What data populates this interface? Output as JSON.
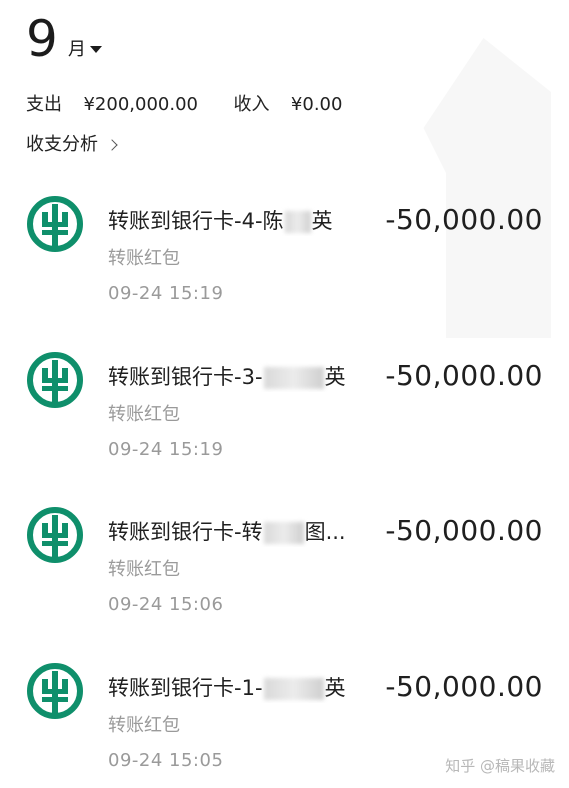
{
  "header": {
    "month": "9",
    "month_unit": "月"
  },
  "summary": {
    "expense_label": "支出",
    "expense_amount": "¥200,000.00",
    "income_label": "收入",
    "income_amount": "¥0.00"
  },
  "analysis": {
    "label": "收支分析"
  },
  "transactions": [
    {
      "title_prefix": "转账到银行卡-4-陈",
      "title_suffix": "英",
      "type": "转账红包",
      "time": "09-24  15:19",
      "amount": "-50,000.00"
    },
    {
      "title_prefix": "转账到银行卡-3-",
      "title_suffix": "英",
      "type": "转账红包",
      "time": "09-24  15:19",
      "amount": "-50,000.00"
    },
    {
      "title_prefix": "转账到银行卡-转",
      "title_suffix": "图...",
      "type": "转账红包",
      "time": "09-24  15:06",
      "amount": "-50,000.00"
    },
    {
      "title_prefix": "转账到银行卡-1-",
      "title_suffix": "英",
      "type": "转账红包",
      "time": "09-24  15:05",
      "amount": "-50,000.00"
    }
  ],
  "watermark": "知乎 @稿果收藏",
  "colors": {
    "bank_logo": "#0f8f6b",
    "primary_text": "#1f1f1f",
    "secondary_text": "#9a9a9a"
  },
  "icons": {
    "bank_logo": "agricultural-bank-logo-icon",
    "month_caret": "caret-down-icon",
    "analysis_arrow": "chevron-right-icon"
  }
}
